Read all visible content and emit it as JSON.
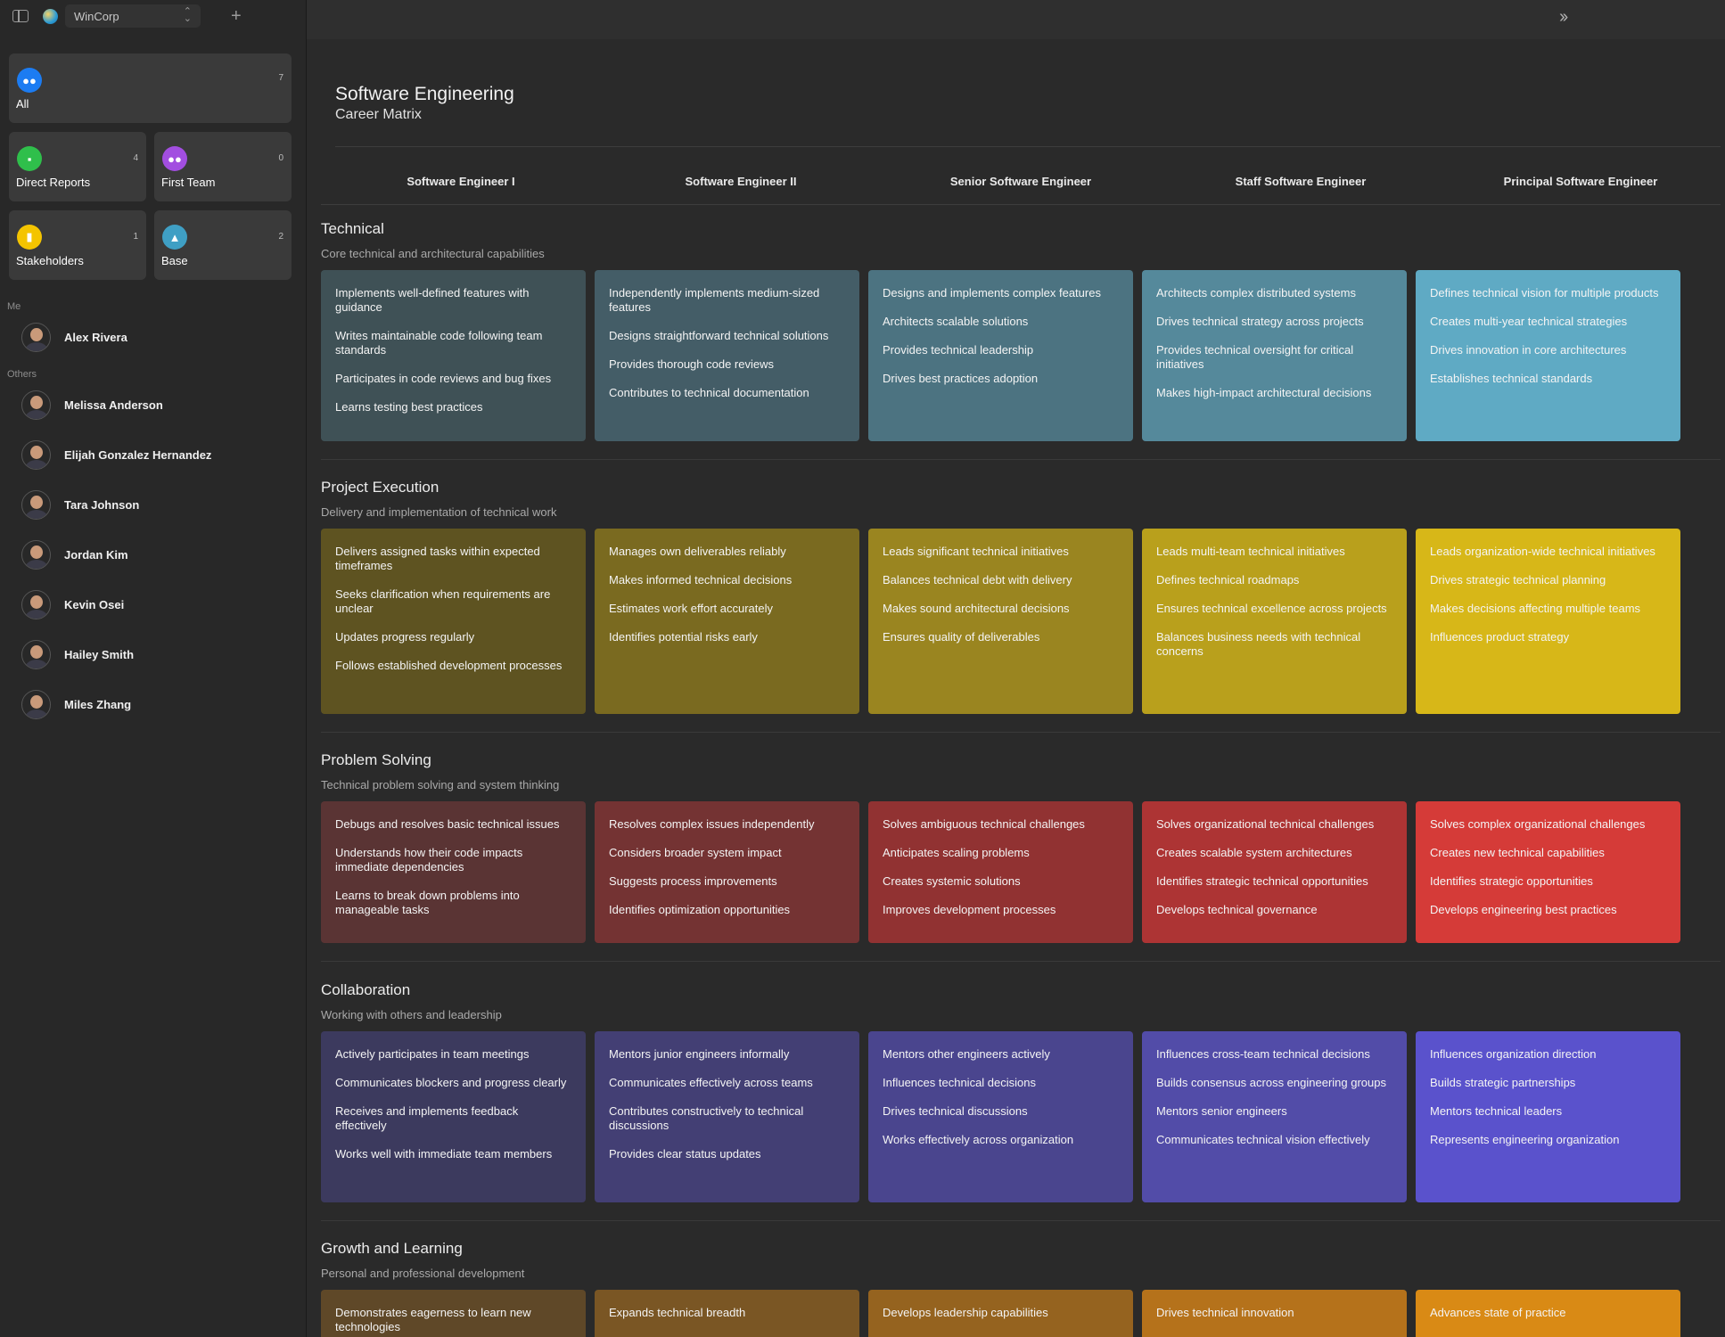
{
  "topbar": {
    "org_name": "WinCorp"
  },
  "groups": {
    "all": {
      "label": "All",
      "count": "7",
      "color": "#1c7cf2"
    },
    "direct_reports": {
      "label": "Direct Reports",
      "count": "4",
      "color": "#2fbf4b"
    },
    "first_team": {
      "label": "First Team",
      "count": "0",
      "color": "#a24ee0"
    },
    "stakeholders": {
      "label": "Stakeholders",
      "count": "1",
      "color": "#f4c400"
    },
    "base": {
      "label": "Base",
      "count": "2",
      "color": "#3f9fc4"
    }
  },
  "me": {
    "section_label": "Me",
    "name": "Alex Rivera"
  },
  "others": {
    "section_label": "Others",
    "people": [
      "Melissa Anderson",
      "Elijah Gonzalez Hernandez",
      "Tara Johnson",
      "Jordan Kim",
      "Kevin Osei",
      "Hailey Smith",
      "Miles Zhang"
    ]
  },
  "page": {
    "title": "Software Engineering",
    "subtitle": "Career Matrix"
  },
  "levels": [
    "Software Engineer I",
    "Software Engineer II",
    "Senior Software Engineer",
    "Staff Software Engineer",
    "Principal Software Engineer"
  ],
  "categories": [
    {
      "title": "Technical",
      "description": "Core technical and architectural capabilities",
      "colors": [
        "#3f5156",
        "#445d67",
        "#4c7381",
        "#55899b",
        "#5faac4"
      ],
      "cells": [
        [
          "Implements well-defined features with guidance",
          "Writes maintainable code following team standards",
          "Participates in code reviews and bug fixes",
          "Learns testing best practices"
        ],
        [
          "Independently implements medium-sized features",
          "Designs straightforward technical solutions",
          "Provides thorough code reviews",
          "Contributes to technical documentation"
        ],
        [
          "Designs and implements complex features",
          "Architects scalable solutions",
          "Provides technical leadership",
          "Drives best practices adoption"
        ],
        [
          "Architects complex distributed systems",
          "Drives technical strategy across projects",
          "Provides technical oversight for critical initiatives",
          "Makes high-impact architectural decisions"
        ],
        [
          "Defines technical vision for multiple products",
          "Creates multi-year technical strategies",
          "Drives innovation in core architectures",
          "Establishes technical standards"
        ]
      ]
    },
    {
      "title": "Project Execution",
      "description": "Delivery and implementation of technical work",
      "colors": [
        "#5e5321",
        "#7a6a20",
        "#9a8520",
        "#b9a01c",
        "#d7b718"
      ],
      "cells": [
        [
          "Delivers assigned tasks within expected timeframes",
          "Seeks clarification when requirements are unclear",
          "Updates progress regularly",
          "Follows established development processes"
        ],
        [
          "Manages own deliverables reliably",
          "Makes informed technical decisions",
          "Estimates work effort accurately",
          "Identifies potential risks early"
        ],
        [
          "Leads significant technical initiatives",
          "Balances technical debt with delivery",
          "Makes sound architectural decisions",
          "Ensures quality of deliverables"
        ],
        [
          "Leads multi-team technical initiatives",
          "Defines technical roadmaps",
          "Ensures technical excellence across projects",
          "Balances business needs with technical concerns"
        ],
        [
          "Leads organization-wide technical initiatives",
          "Drives strategic technical planning",
          "Makes decisions affecting multiple teams",
          "Influences product strategy"
        ]
      ]
    },
    {
      "title": "Problem Solving",
      "description": "Technical problem solving and system thinking",
      "colors": [
        "#5a3434",
        "#743333",
        "#913232",
        "#ad3434",
        "#d53b38"
      ],
      "cells": [
        [
          "Debugs and resolves basic technical issues",
          "Understands how their code impacts immediate dependencies",
          "Learns to break down problems into manageable tasks"
        ],
        [
          "Resolves complex issues independently",
          "Considers broader system impact",
          "Suggests process improvements",
          "Identifies optimization opportunities"
        ],
        [
          "Solves ambiguous technical challenges",
          "Anticipates scaling problems",
          "Creates systemic solutions",
          "Improves development processes"
        ],
        [
          "Solves organizational technical challenges",
          "Creates scalable system architectures",
          "Identifies strategic technical opportunities",
          "Develops technical governance"
        ],
        [
          "Solves complex organizational challenges",
          "Creates new technical capabilities",
          "Identifies strategic opportunities",
          "Develops engineering best practices"
        ]
      ]
    },
    {
      "title": "Collaboration",
      "description": "Working with others and leadership",
      "colors": [
        "#3c3a5e",
        "#433f74",
        "#4a458e",
        "#524ca8",
        "#5a52cc"
      ],
      "cells": [
        [
          "Actively participates in team meetings",
          "Communicates blockers and progress clearly",
          "Receives and implements feedback effectively",
          "Works well with immediate team members"
        ],
        [
          "Mentors junior engineers informally",
          "Communicates effectively across teams",
          "Contributes constructively to technical discussions",
          "Provides clear status updates"
        ],
        [
          "Mentors other engineers actively",
          "Influences technical decisions",
          "Drives technical discussions",
          "Works effectively across organization"
        ],
        [
          "Influences cross-team technical decisions",
          "Builds consensus across engineering groups",
          "Mentors senior engineers",
          "Communicates technical vision effectively"
        ],
        [
          "Influences organization direction",
          "Builds strategic partnerships",
          "Mentors technical leaders",
          "Represents engineering organization"
        ]
      ]
    },
    {
      "title": "Growth and Learning",
      "description": "Personal and professional development",
      "colors": [
        "#5f4828",
        "#7a5624",
        "#95631f",
        "#b5721b",
        "#d98a15"
      ],
      "cells": [
        [
          "Demonstrates eagerness to learn new technologies"
        ],
        [
          "Expands technical breadth"
        ],
        [
          "Develops leadership capabilities"
        ],
        [
          "Drives technical innovation"
        ],
        [
          "Advances state of practice"
        ]
      ]
    }
  ]
}
